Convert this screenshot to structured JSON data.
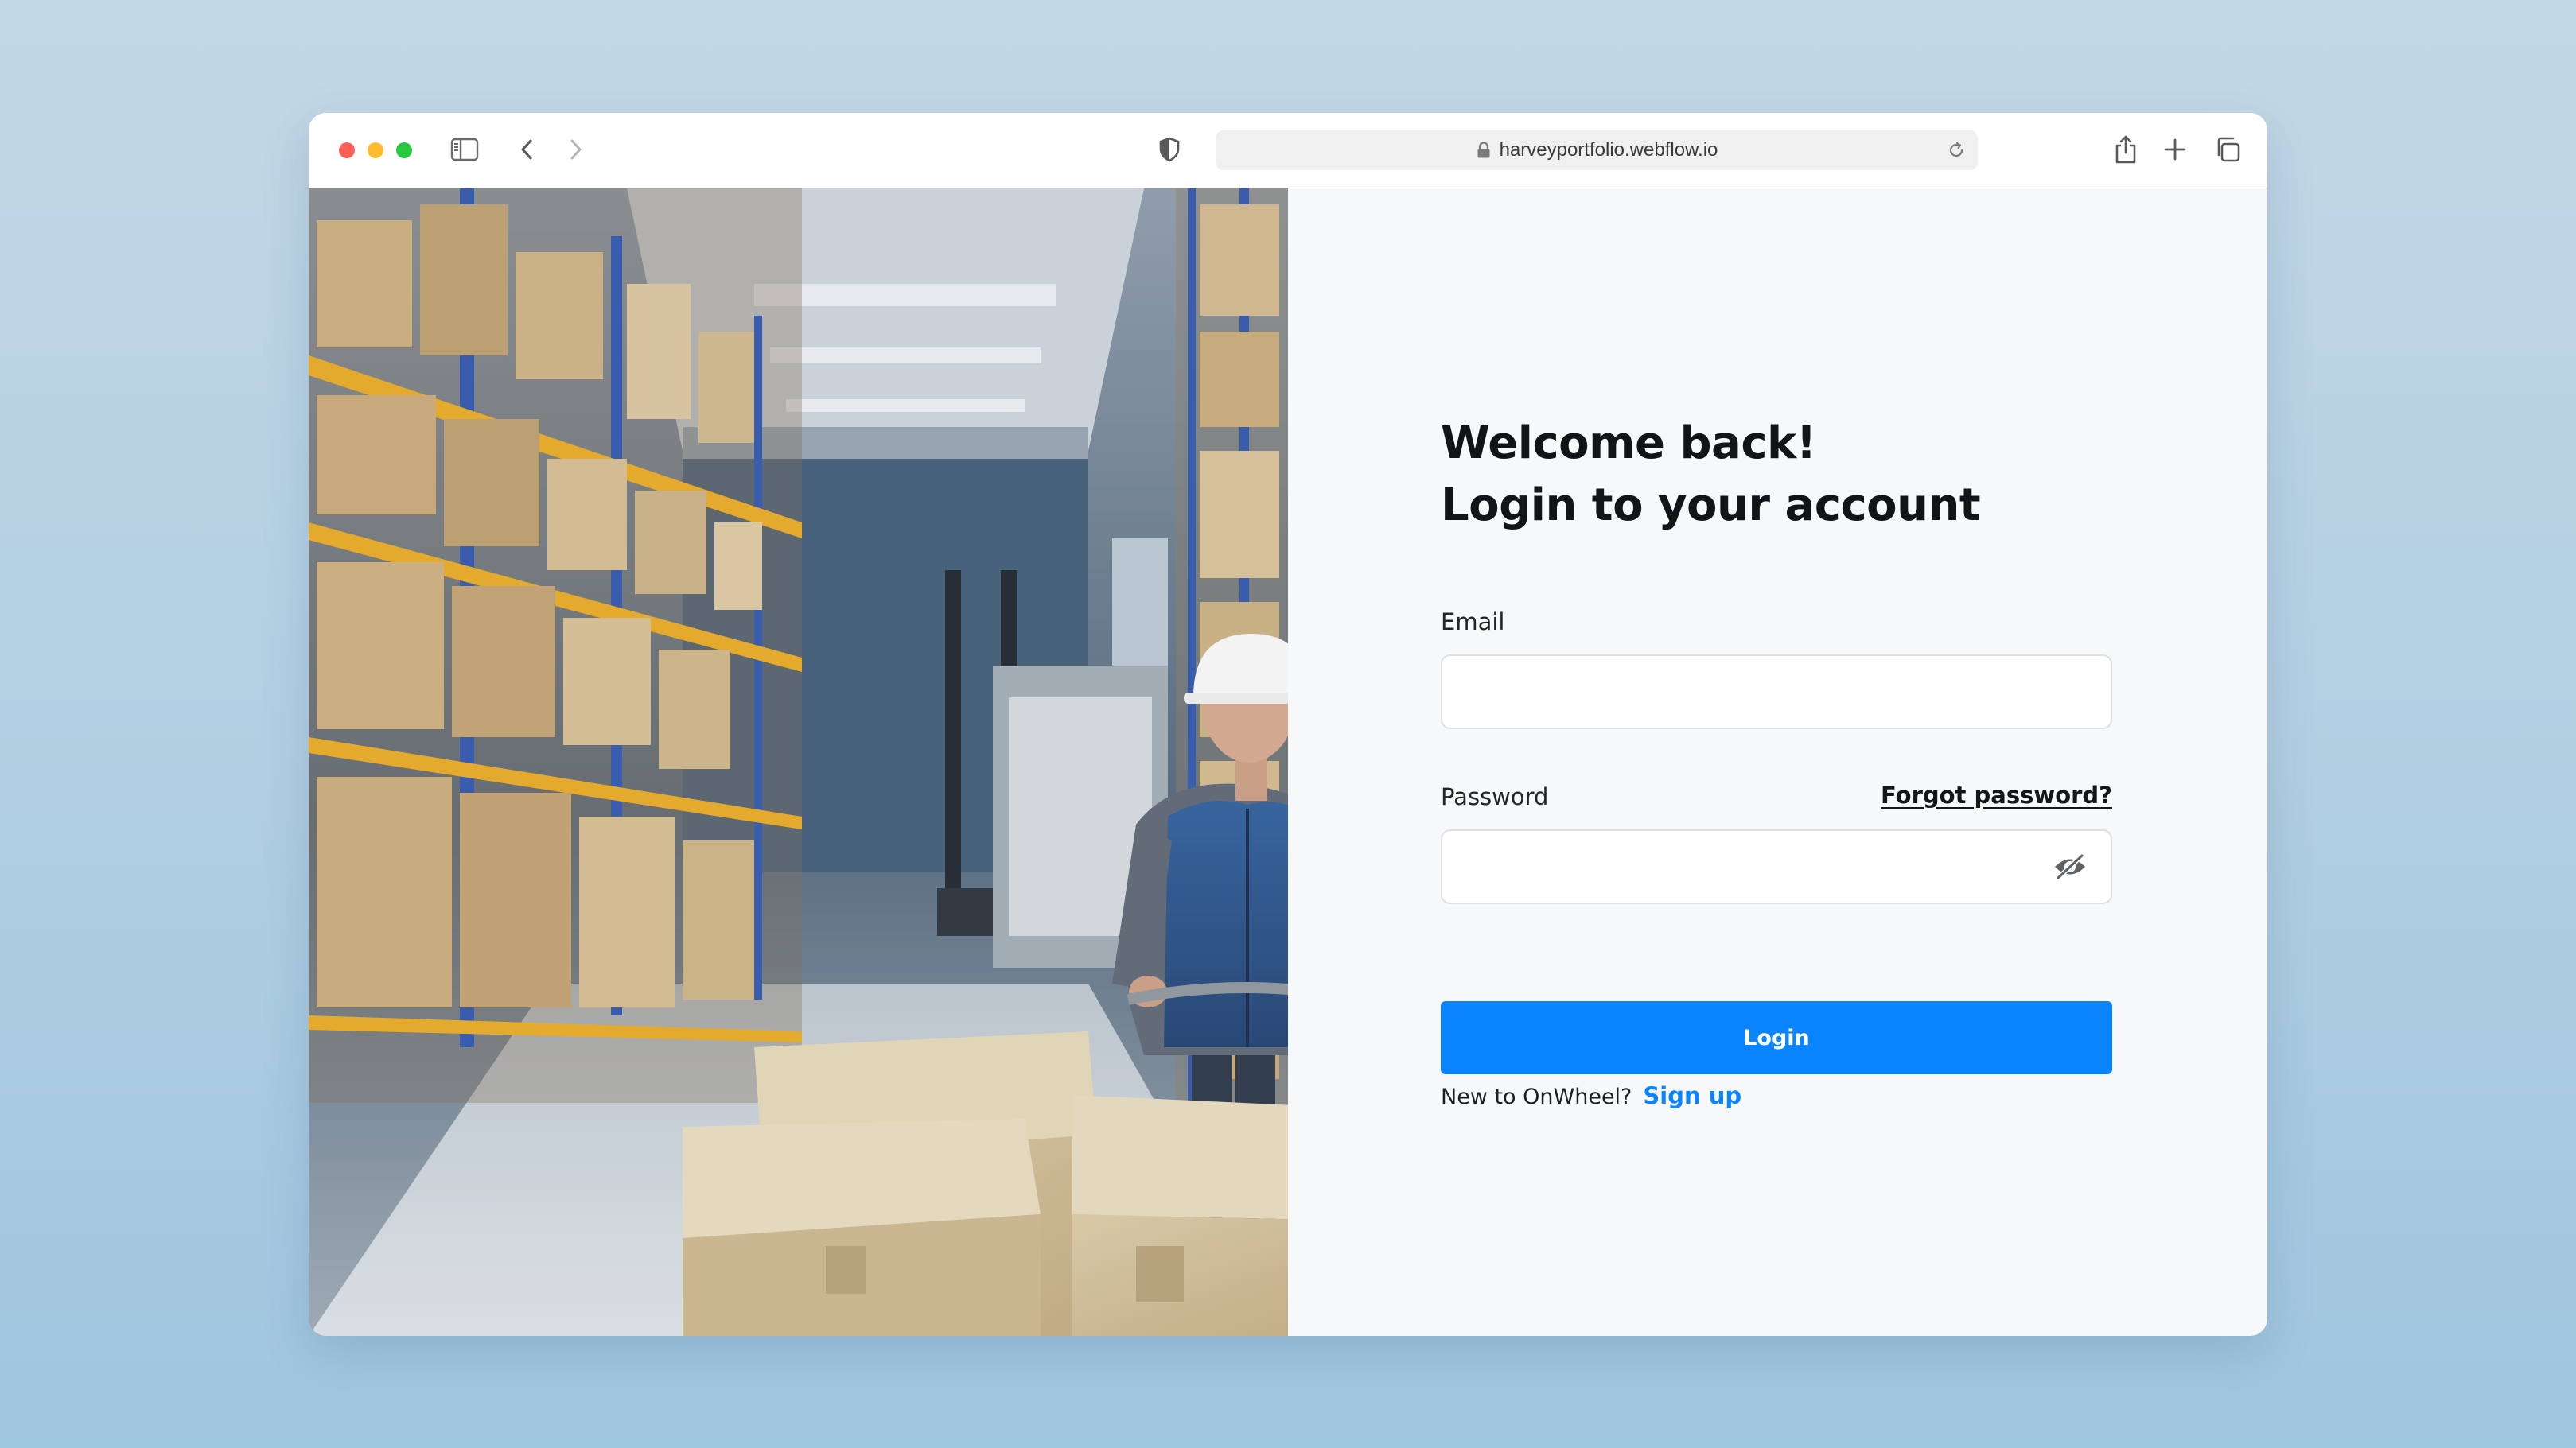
{
  "browser": {
    "url": "harveyportfolio.webflow.io"
  },
  "hero": {
    "image": "warehouse-worker-photo"
  },
  "login": {
    "heading_line1": "Welcome back!",
    "heading_line2": "Login to your account",
    "email_label": "Email",
    "email_value": "",
    "password_label": "Password",
    "password_value": "",
    "forgot_password": "Forgot password?",
    "login_button": "Login",
    "signup_prompt": "New to OnWheel?",
    "signup_link": "Sign up"
  },
  "colors": {
    "accent": "#0a84ff",
    "logo_dark": "#0b2a55",
    "panel_bg": "#f6f8fa"
  },
  "icons": {
    "password_toggle": "eye-slash-icon",
    "brand": "onwheel-logo"
  }
}
